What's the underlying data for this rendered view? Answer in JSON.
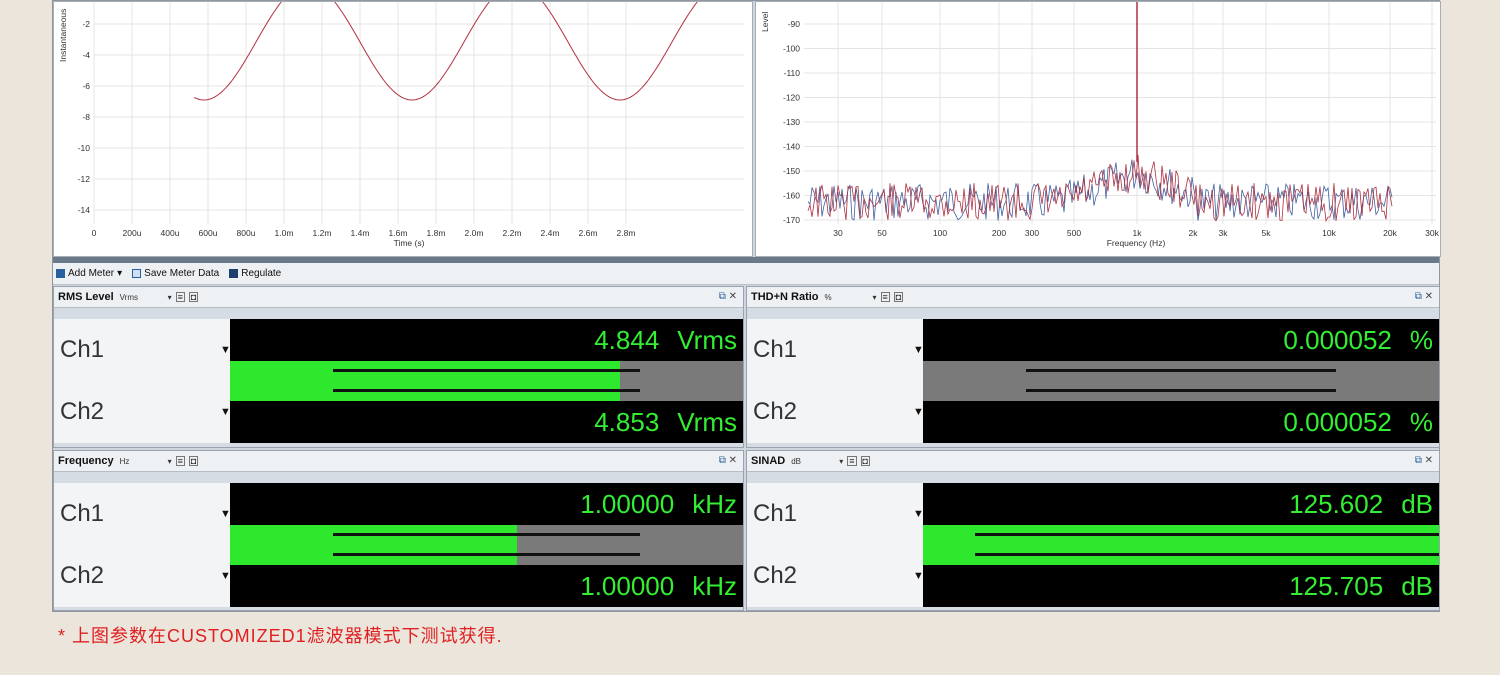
{
  "time_graph": {
    "ylabel": "Instantaneous",
    "xlabel": "Time (s)",
    "y_ticks": [
      "-2",
      "-4",
      "-6",
      "-8",
      "-10",
      "-12",
      "-14"
    ],
    "x_ticks": [
      "0",
      "200u",
      "400u",
      "600u",
      "800u",
      "1.0m",
      "1.2m",
      "1.4m",
      "1.6m",
      "1.8m",
      "2.0m",
      "2.2m",
      "2.4m",
      "2.6m",
      "2.8m"
    ]
  },
  "fft_graph": {
    "ylabel": "Level",
    "xlabel": "Frequency (Hz)",
    "y_ticks": [
      "-90",
      "-100",
      "-110",
      "-120",
      "-130",
      "-140",
      "-150",
      "-160",
      "-170"
    ],
    "x_ticks": [
      "30",
      "50",
      "100",
      "200",
      "300",
      "500",
      "1k",
      "2k",
      "3k",
      "5k",
      "10k",
      "20k",
      "30k"
    ]
  },
  "toolbar": {
    "add_meter": "Add Meter",
    "save_meter_data": "Save Meter Data",
    "regulate": "Regulate"
  },
  "meters": {
    "rms": {
      "title": "RMS Level",
      "unit_select": "Vrms",
      "ch1_label": "Ch1",
      "ch1_value": "4.844",
      "ch1_unit": "Vrms",
      "ch2_label": "Ch2",
      "ch2_value": "4.853",
      "ch2_unit": "Vrms",
      "ch1_level": 0.76,
      "ch2_level": 0.76
    },
    "thdn": {
      "title": "THD+N Ratio",
      "unit_select": "%",
      "ch1_label": "Ch1",
      "ch1_value": "0.000052",
      "ch1_unit": "%",
      "ch2_label": "Ch2",
      "ch2_value": "0.000052",
      "ch2_unit": "%",
      "ch1_level": 0.0,
      "ch2_level": 0.0
    },
    "freq": {
      "title": "Frequency",
      "unit_select": "Hz",
      "ch1_label": "Ch1",
      "ch1_value": "1.00000",
      "ch1_unit": "kHz",
      "ch2_label": "Ch2",
      "ch2_value": "1.00000",
      "ch2_unit": "kHz",
      "ch1_level": 0.56,
      "ch2_level": 0.56
    },
    "sinad": {
      "title": "SINAD",
      "unit_select": "dB",
      "ch1_label": "Ch1",
      "ch1_value": "125.602",
      "ch1_unit": "dB",
      "ch2_label": "Ch2",
      "ch2_value": "125.705",
      "ch2_unit": "dB",
      "ch1_level": 1.0,
      "ch2_level": 1.0
    }
  },
  "footnote": "* 上图参数在CUSTOMIZED1滤波器模式下测试获得.",
  "colors": {
    "meter_green": "#2ee82e",
    "meter_bg": "#000000",
    "trace_red": "#b03040",
    "trace_blue": "#4060a0"
  }
}
